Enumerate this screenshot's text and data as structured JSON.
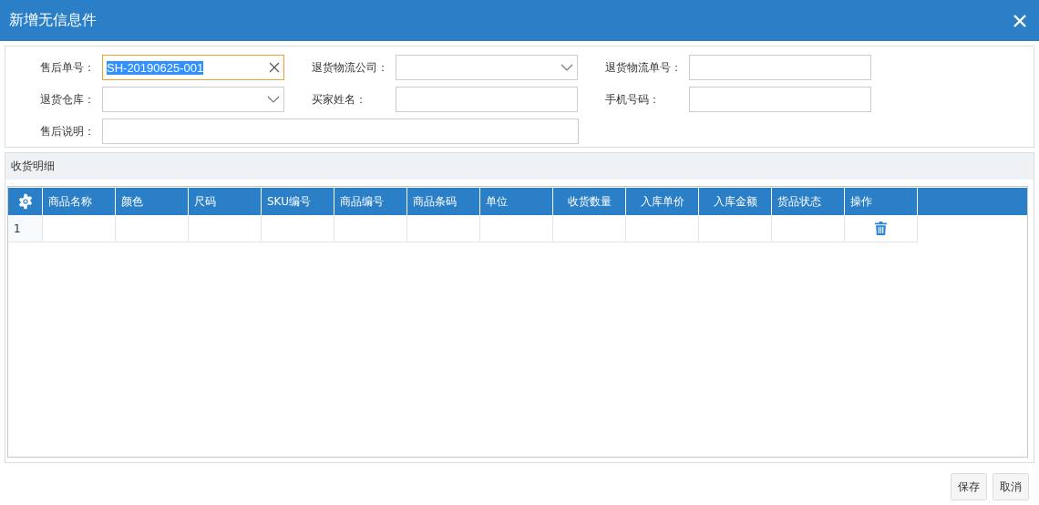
{
  "window": {
    "title": "新增无信息件"
  },
  "form": {
    "fields": [
      {
        "label": "售后单号：",
        "kind": "text",
        "value": "SH-20190625-001",
        "focused": true
      },
      {
        "label": "退货物流公司：",
        "kind": "select",
        "focused": false
      },
      {
        "label": "退货物流单号：",
        "kind": "text",
        "focused": false
      },
      {
        "label": "退货仓库：",
        "kind": "select",
        "focused": false
      },
      {
        "label": "买家姓名：",
        "kind": "text",
        "focused": false
      },
      {
        "label": "手机号码：",
        "kind": "text",
        "focused": false
      },
      {
        "label": "售后说明：",
        "kind": "wide",
        "focused": false
      }
    ]
  },
  "details": {
    "title": "收货明细",
    "columns": [
      {
        "label": "商品名称",
        "numeric": false
      },
      {
        "label": "颜色",
        "numeric": false
      },
      {
        "label": "尺码",
        "numeric": false
      },
      {
        "label": "SKU编号",
        "numeric": false
      },
      {
        "label": "商品编号",
        "numeric": false
      },
      {
        "label": "商品条码",
        "numeric": false
      },
      {
        "label": "单位",
        "numeric": false
      },
      {
        "label": "收货数量",
        "numeric": true
      },
      {
        "label": "入库单价",
        "numeric": true
      },
      {
        "label": "入库金额",
        "numeric": true
      },
      {
        "label": "货品状态",
        "numeric": false
      },
      {
        "label": "操作",
        "numeric": false,
        "kind": "action"
      }
    ],
    "rows": [
      {
        "number": "1"
      }
    ]
  },
  "buttons": [
    "保存",
    "取消"
  ]
}
